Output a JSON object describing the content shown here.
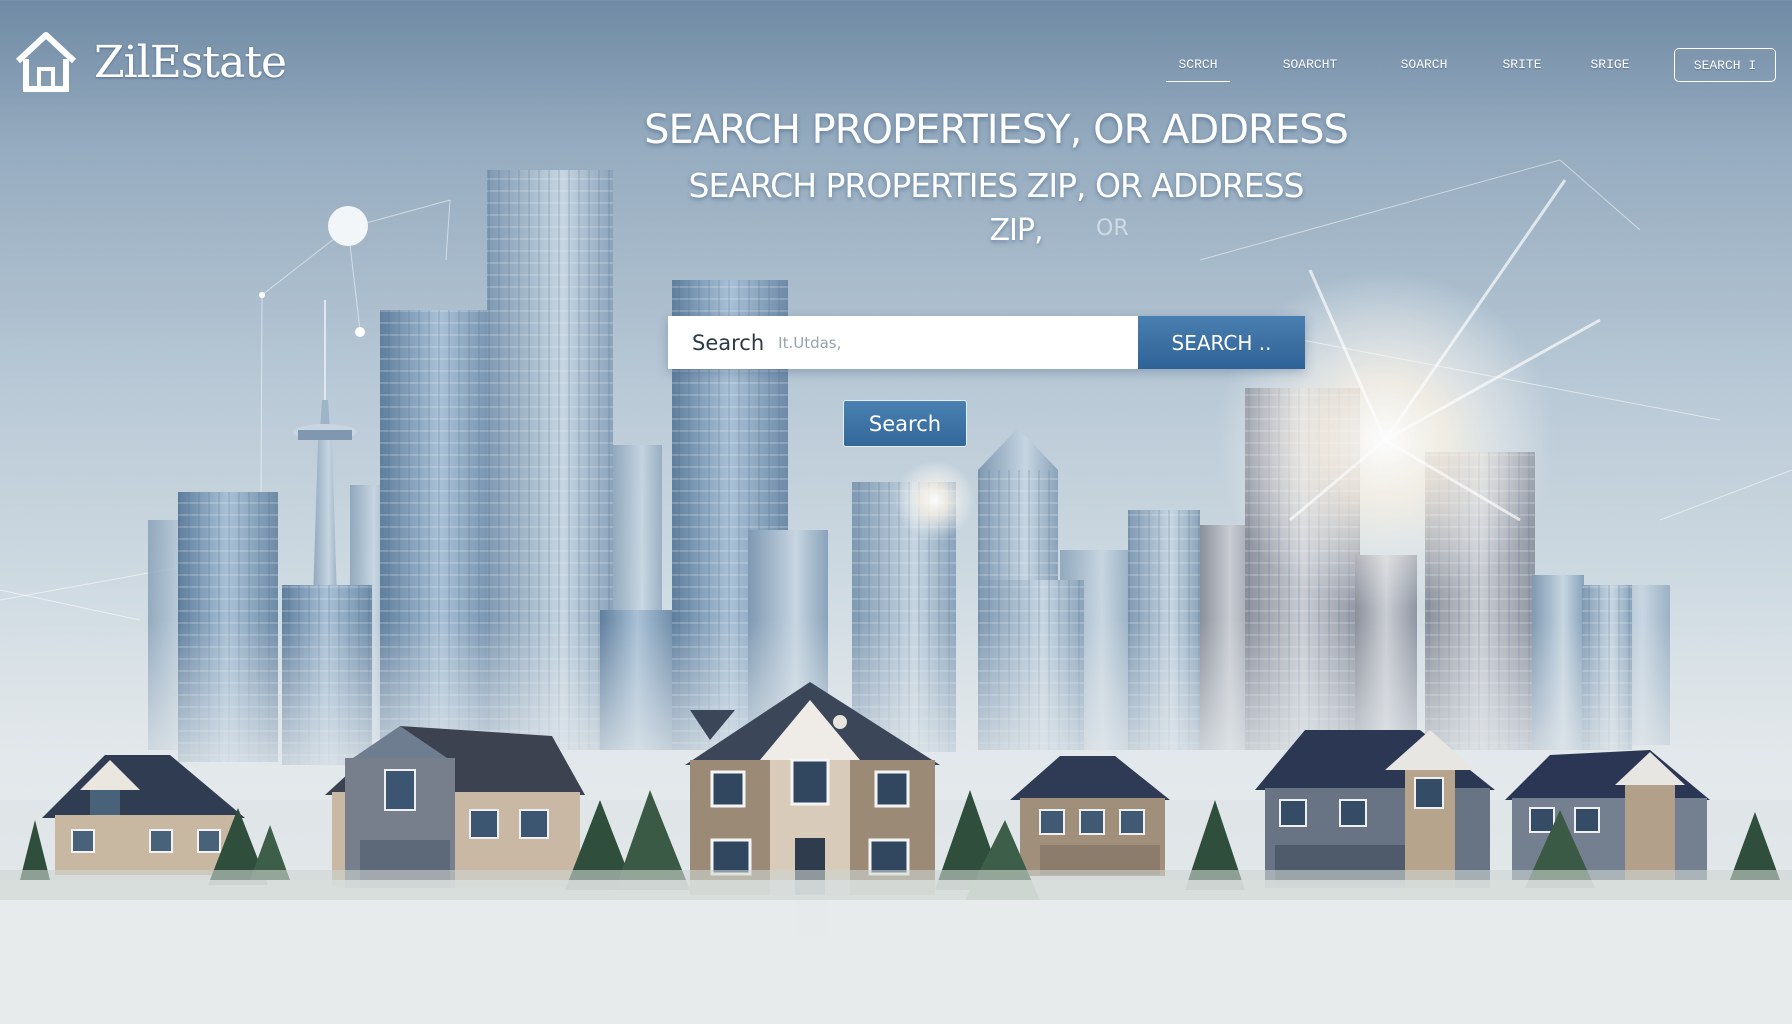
{
  "brand": {
    "name": "ZilEstate",
    "icon": "house-icon"
  },
  "nav": {
    "items": [
      "SCRCH",
      "SOARCHT",
      "SOARCH",
      "SRITE",
      "SRIGE",
      "SEARCH I"
    ],
    "active_index": 0,
    "boxed_index": 5
  },
  "hero": {
    "headline_1": "SEARCH PROPERTIESY, OR ADDRESS",
    "headline_2": "SEARCH PROPERTIES  ZIP, OR ADDRESS",
    "headline_3": "ZIP,",
    "headline_ghost": "OR"
  },
  "search": {
    "value": "Search",
    "placeholder": "It.Utdas,",
    "button_label": "SEARCH ..",
    "secondary_button_label": "Search"
  },
  "colors": {
    "accent": "#3a6fa3",
    "sky_top": "#6f8aa4",
    "ground": "#e7ebec"
  }
}
